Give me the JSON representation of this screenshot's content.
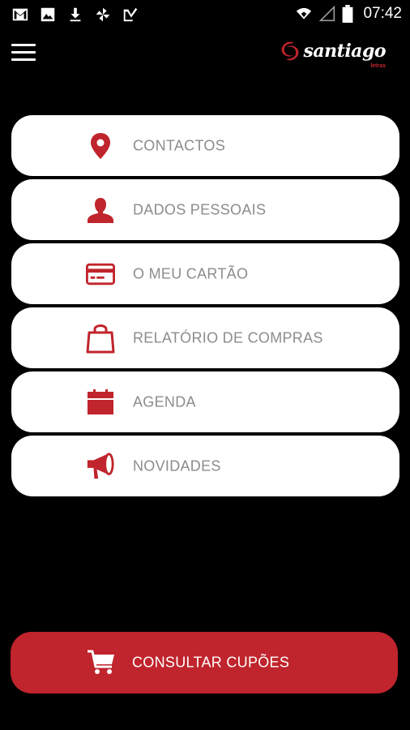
{
  "status_bar": {
    "time": "07:42",
    "left_icons": [
      "gmail-icon",
      "image-icon",
      "download-icon",
      "pinwheel-icon",
      "checklist-icon"
    ],
    "right_icons": [
      "wifi-icon",
      "signal-icon",
      "battery-icon"
    ]
  },
  "app_bar": {
    "menu_icon": "hamburger-menu-icon",
    "logo_text": "santiago",
    "logo_subtext": "letras"
  },
  "menu": {
    "items": [
      {
        "label": "CONTACTOS",
        "icon": "location-pin-icon"
      },
      {
        "label": "DADOS PESSOAIS",
        "icon": "person-icon"
      },
      {
        "label": "O MEU CARTÃO",
        "icon": "card-icon"
      },
      {
        "label": "RELATÓRIO DE COMPRAS",
        "icon": "shopping-bag-icon"
      },
      {
        "label": "AGENDA",
        "icon": "calendar-icon"
      },
      {
        "label": "NOVIDADES",
        "icon": "megaphone-icon"
      }
    ]
  },
  "coupons_button": {
    "label": "CONSULTAR CUPÕES",
    "icon": "shopping-cart-icon"
  },
  "colors": {
    "accent": "#c0242c",
    "background": "#000000",
    "item_background": "#ffffff",
    "item_text": "#8c8c8c"
  }
}
